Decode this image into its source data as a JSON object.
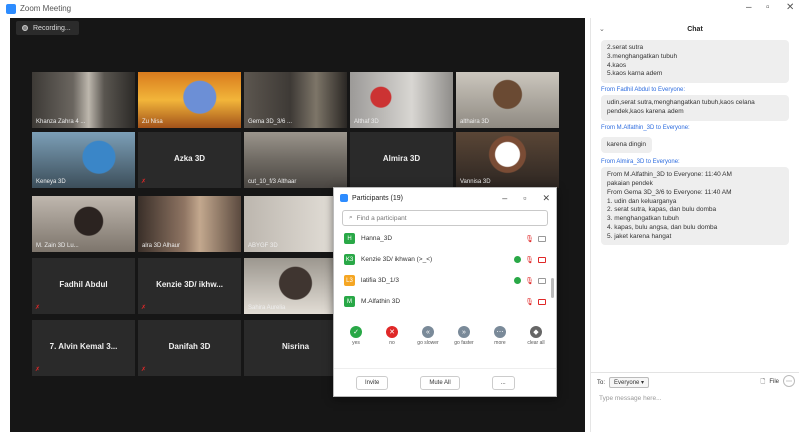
{
  "window": {
    "title": "Zoom Meeting",
    "minimize": "–",
    "maximize": "▫",
    "close": "✕"
  },
  "recording": {
    "label": "Recording..."
  },
  "tiles": [
    {
      "name": "Khanza Zahra 4 ..."
    },
    {
      "name": "Zu Nisa"
    },
    {
      "name": "Gema 3D_3/6 ..."
    },
    {
      "name": "Althaf 3D"
    },
    {
      "name": "althaira 3D"
    },
    {
      "name": "Keneya 3D"
    },
    {
      "name": "Azka 3D"
    },
    {
      "name": "cut_10_f/3 Althaar"
    },
    {
      "name": "Almira 3D"
    },
    {
      "name": "Vannisa 3D"
    },
    {
      "name": "M. Zain 3D Lu..."
    },
    {
      "name": "alra 3D Alhaur"
    },
    {
      "name": "ABYGF 3D"
    },
    {
      "name": "Fadhil Abdul"
    },
    {
      "name": "Kenzie 3D/ ikhw..."
    },
    {
      "name": "Sahira Aurelia"
    },
    {
      "name": "7. Alvin Kemal 3..."
    },
    {
      "name": "Danifah 3D"
    },
    {
      "name": "Nisrina"
    }
  ],
  "participants": {
    "title": "Participants (19)",
    "search_placeholder": "Find a participant",
    "rows": [
      {
        "initial": "H",
        "name": "Hanna_3D",
        "color": "#29a847"
      },
      {
        "initial": "K3",
        "name": "Kenzie 3D/ ikhwan (>_<)",
        "color": "#29a847"
      },
      {
        "initial": "L3",
        "name": "latifia 3D_1/3",
        "color": "#f5a623"
      },
      {
        "initial": "M",
        "name": "M.Alfathin 3D",
        "color": "#29a847"
      }
    ],
    "reactions": [
      {
        "label": "yes",
        "glyph": "✓",
        "color": "#29a847"
      },
      {
        "label": "no",
        "glyph": "✕",
        "color": "#e02828"
      },
      {
        "label": "go slower",
        "glyph": "«",
        "color": "#7a8a99"
      },
      {
        "label": "go faster",
        "glyph": "»",
        "color": "#7a8a99"
      },
      {
        "label": "more",
        "glyph": "⋯",
        "color": "#7a8a99"
      },
      {
        "label": "clear all",
        "glyph": "◆",
        "color": "#666666"
      }
    ],
    "invite": "Invite",
    "mute_all": "Mute All",
    "more": "..."
  },
  "chat": {
    "title": "Chat",
    "messages": [
      {
        "from": "",
        "text": "2.serat sutra\n3.menghangatkan tubuh\n4.kaos\n5.kaos karna adem"
      },
      {
        "from": "From Fadhil Abdul to Everyone:",
        "text": "udin,serat sutra,menghangatkan tubuh,kaos celana pendek,kaos karena adem"
      },
      {
        "from": "From M.Alfathin_3D to Everyone:",
        "text": "karena dingin"
      },
      {
        "from": "From Almira_3D to Everyone:",
        "text": "From M.Alfathin_3D to Everyone: 11:40 AM\npakaian pendek\nFrom Gema 3D_3/6 to Everyone: 11:40 AM\n1. udin dan keluarganya\n2. serat sutra, kapas, dan bulu domba\n3. menghangatkan tubuh\n4. kapas, bulu angsa, dan bulu domba\n5. jaket karena hangat"
      }
    ],
    "to_label": "To:",
    "to_value": "Everyone ▾",
    "file_label": "File",
    "placeholder": "Type message here..."
  }
}
